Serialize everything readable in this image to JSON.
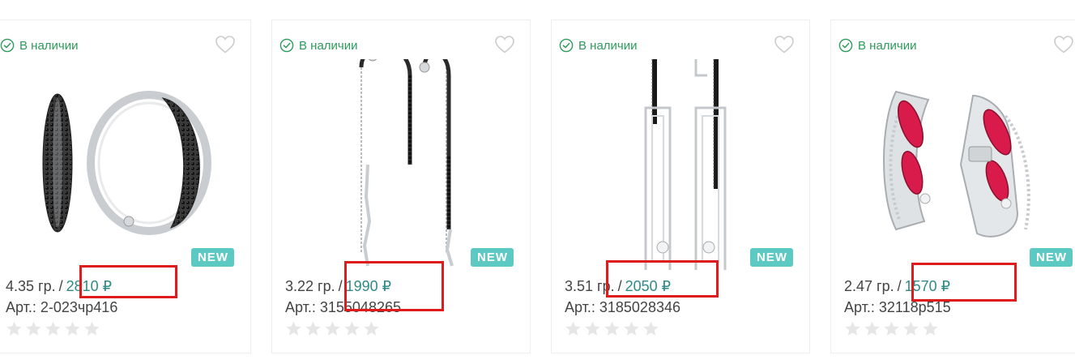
{
  "products": [
    {
      "availability": "В наличии",
      "weight": "4.35 гр.",
      "separator": "/",
      "price": "2810 ₽",
      "article": "Арт.: 2-023чр416",
      "badge": "NEW",
      "rating": 0,
      "image_icon": "black-pave-hoop-earrings"
    },
    {
      "availability": "В наличии",
      "weight": "3.22 гр.",
      "separator": "/",
      "price": "1990 ₽",
      "article": "Арт.: 3155048265",
      "badge": "NEW",
      "rating": 0,
      "image_icon": "threader-chain-earrings"
    },
    {
      "availability": "В наличии",
      "weight": "3.51 гр.",
      "separator": "/",
      "price": "2050 ₽",
      "article": "Арт.: 3185028346",
      "badge": "NEW",
      "rating": 0,
      "image_icon": "geometric-bar-earrings"
    },
    {
      "availability": "В наличии",
      "weight": "2.47 гр.",
      "separator": "/",
      "price": "1570 ₽",
      "article": "Арт.: 32118р515",
      "badge": "NEW",
      "rating": 0,
      "image_icon": "ruby-marquise-earrings"
    }
  ],
  "colors": {
    "availability": "#2e9a5c",
    "price": "#2f8a86",
    "badge": "#5cc9c3",
    "highlight": "#e01b1b",
    "star_empty": "#e6e6e6",
    "heart_outline": "#cccccc"
  }
}
